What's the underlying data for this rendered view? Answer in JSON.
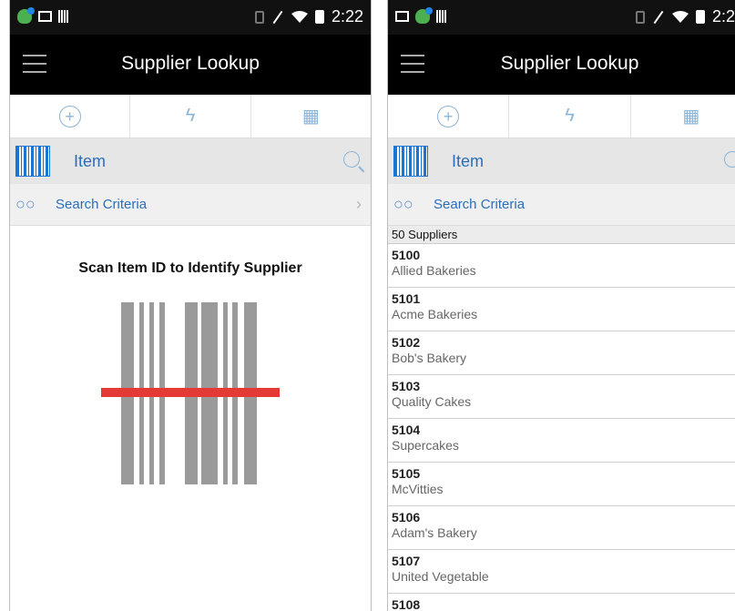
{
  "status": {
    "time": "2:22"
  },
  "app": {
    "title": "Supplier Lookup"
  },
  "actions": [
    {
      "icon": "add-circle-icon",
      "glyph": "+"
    },
    {
      "icon": "lightning-icon",
      "glyph": "ϟ"
    },
    {
      "icon": "cube-icon",
      "glyph": "▦"
    }
  ],
  "item": {
    "label": "Item"
  },
  "search_criteria": {
    "label": "Search Criteria"
  },
  "scan": {
    "prompt": "Scan Item ID to Identify Supplier"
  },
  "results": {
    "count": "50 Suppliers",
    "rows": [
      {
        "id": "5100",
        "name": "Allied Bakeries"
      },
      {
        "id": "5101",
        "name": "Acme Bakeries"
      },
      {
        "id": "5102",
        "name": "Bob's Bakery"
      },
      {
        "id": "5103",
        "name": "Quality Cakes"
      },
      {
        "id": "5104",
        "name": "Supercakes"
      },
      {
        "id": "5105",
        "name": "McVitties"
      },
      {
        "id": "5106",
        "name": "Adam's Bakery"
      },
      {
        "id": "5107",
        "name": "United Vegetable"
      },
      {
        "id": "5108",
        "name": ""
      }
    ]
  },
  "colors": {
    "appbar": "#000000",
    "accent": "#2a6ebb",
    "laser": "#e53935"
  }
}
